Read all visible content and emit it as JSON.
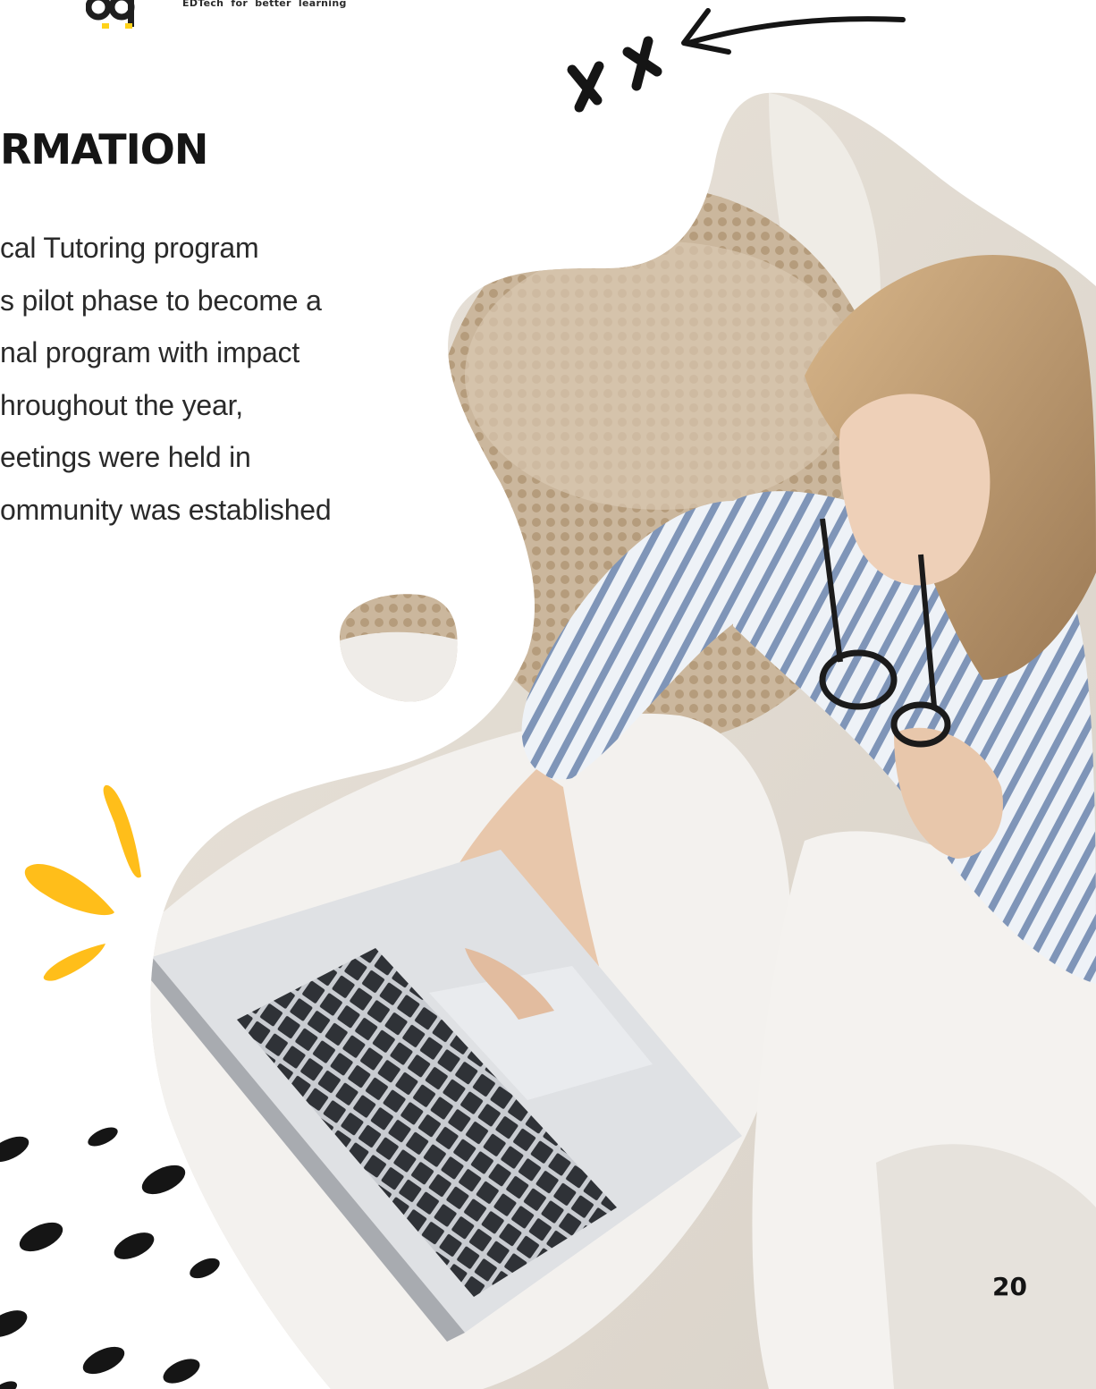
{
  "header": {
    "logo_name": "qq-logo",
    "tagline": "EDTech for better learning"
  },
  "main": {
    "heading": "RMATION",
    "paragraph_lines": [
      "cal Tutoring program",
      "s pilot phase to become a",
      "nal program with impact",
      "hroughout the year,",
      "eetings were held in",
      "ommunity was established"
    ]
  },
  "footer": {
    "page_number": "20"
  },
  "colors": {
    "accent_yellow": "#FFBE1A",
    "ink": "#151515",
    "photo_bg": "#d8cdbd"
  }
}
